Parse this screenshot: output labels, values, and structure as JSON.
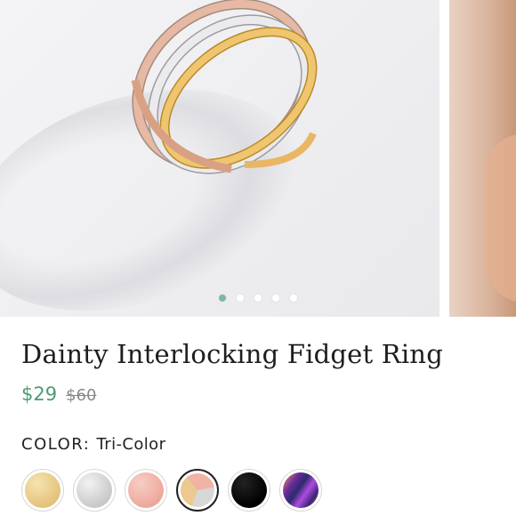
{
  "gallery": {
    "dots_total": 5,
    "dots_active_index": 0
  },
  "product": {
    "title": "Dainty Interlocking Fidget Ring",
    "price": "$29",
    "compare_price": "$60"
  },
  "color": {
    "label": "COLOR",
    "value": "Tri-Color"
  },
  "swatches": [
    {
      "name": "gold",
      "background": "radial-gradient(circle at 35% 30%, #f6e3b0, #e7c783 60%, #d9b46a)"
    },
    {
      "name": "silver",
      "background": "radial-gradient(circle at 35% 30%, #f2f2f2, #cfcfcf 60%, #b9b9b9)"
    },
    {
      "name": "rose-gold",
      "background": "radial-gradient(circle at 35% 30%, #f7cdc4, #efaea3 60%, #e39b90)"
    },
    {
      "name": "tri-color",
      "background": "conic-gradient(from 200deg, #ecc98e 0deg 120deg, #f0b3a6 120deg 240deg, #d7d7d7 240deg 360deg)"
    },
    {
      "name": "black",
      "background": "radial-gradient(circle at 35% 30%, #222, #000 70%)"
    },
    {
      "name": "rainbow",
      "background": "linear-gradient(125deg, #f2a24a 0%, #6a2b9e 28%, #2f2a6e 45%, #b14be0 62%, #3a2478 80%, #e26f3a 100%)"
    }
  ],
  "selected_swatch": "tri-color"
}
